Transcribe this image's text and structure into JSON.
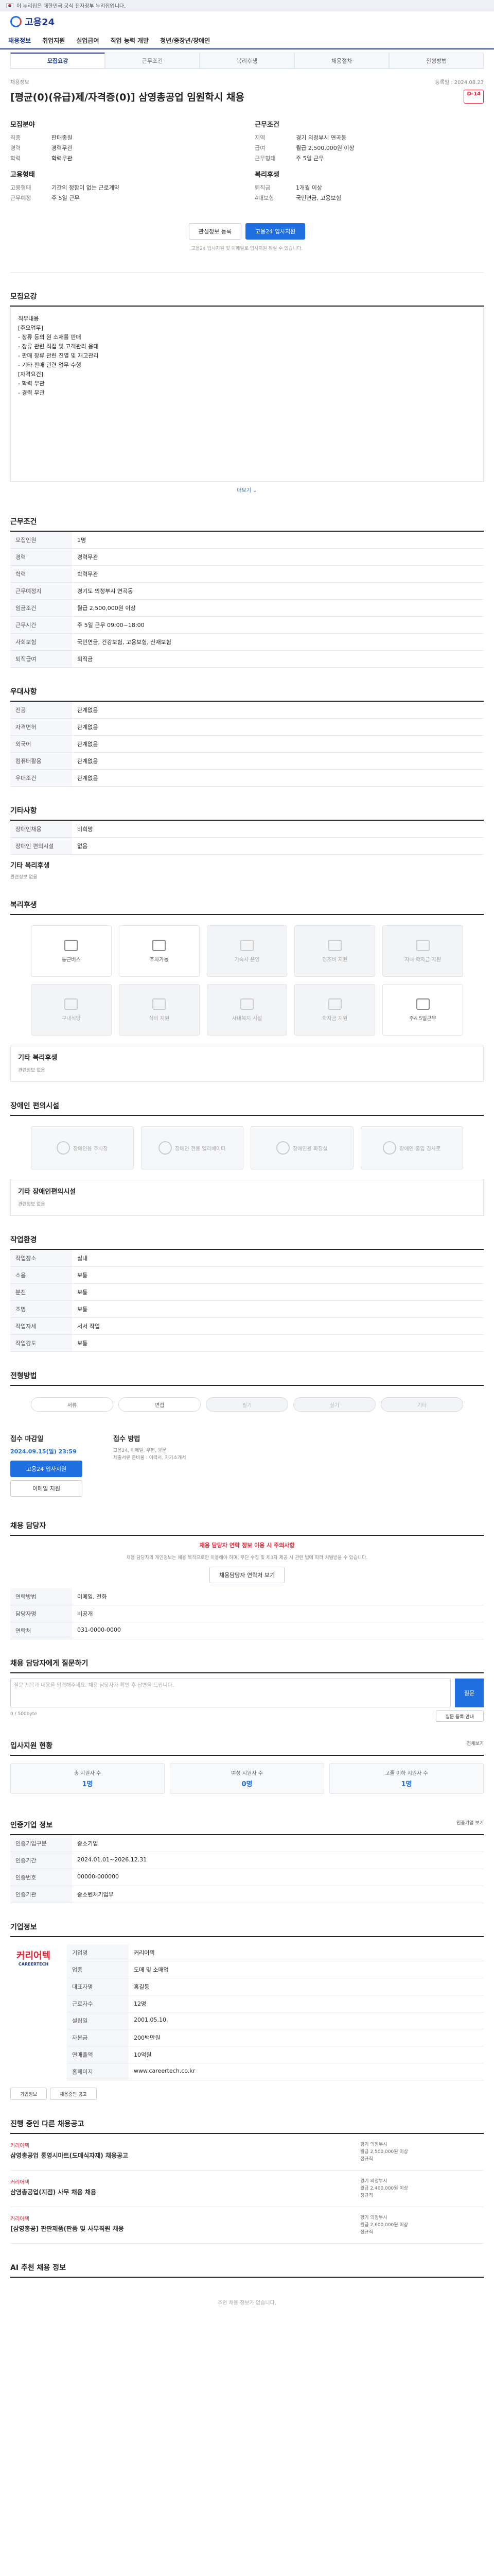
{
  "gov": {
    "text": "이 누리집은 대한민국 공식 전자정부 누리집입니다."
  },
  "site": {
    "name": "고용24",
    "nav": [
      "채용정보",
      "취업지원",
      "실업급여",
      "직업 능력 개발",
      "청년/중장년/장애인"
    ]
  },
  "tabs": [
    "모집요강",
    "근무조건",
    "복리후생",
    "채용절차",
    "전형방법"
  ],
  "job": {
    "meta_left": "채용정보",
    "meta_right": "등록일 : 2024.08.23",
    "title": "[평균(0)(유급)제/자격증(0)] 삼영총공업 임원학시 채용",
    "dday": "D-14",
    "left_label": "모집분야",
    "left_rows": [
      [
        "직종",
        "판매종원"
      ],
      [
        "경력",
        "경력무관"
      ],
      [
        "학력",
        "학력무관"
      ]
    ],
    "right_label": "근무조건",
    "right_rows": [
      [
        "지역",
        "경기 의정부시 연곡동"
      ],
      [
        "급여",
        "월급 2,500,000원 이상"
      ],
      [
        "근무형태",
        "주 5일 근무"
      ]
    ],
    "co_label": "고용형태",
    "co_rows": [
      [
        "고용형태",
        "기간의 정함이 없는 근로계약"
      ],
      [
        "근무예정",
        "주 5일 근무"
      ]
    ],
    "wel_label": "복리후생",
    "wel_rows": [
      [
        "퇴직금",
        "1개월 이상"
      ],
      [
        "4대보험",
        "국민연금, 고용보험"
      ]
    ],
    "btn_scrap": "관심정보 등록",
    "btn_apply": "고용24 입사지원",
    "note": "고용24 입사지원 및 이메일로 입사지원 하실 수 있습니다."
  },
  "sections": {
    "recruit": {
      "title": "모집요강",
      "body": "직무내용\n[주요업무]\n- 장류 등의 원 소재를 판매\n- 장류 관련 직접 및 고객관리 응대\n- 판매 장류 관련 진열 및 재고관리\n- 기타 판매 관련 업무 수행\n[자격요건]\n- 학력 무관\n- 경력 무관",
      "more": "더보기 ⌄"
    },
    "cond": {
      "title": "근무조건",
      "rows": [
        [
          "모집인원",
          "1명"
        ],
        [
          "경력",
          "경력무관"
        ],
        [
          "학력",
          "학력무관"
        ],
        [
          "근무예정지",
          "경기도 의정부시 연곡동"
        ],
        [
          "임금조건",
          "월급 2,500,000원 이상"
        ],
        [
          "근무시간",
          "주 5일 근무 09:00~18:00"
        ],
        [
          "사회보험",
          "국민연금, 건강보험, 고용보험, 산재보험"
        ],
        [
          "퇴직급여",
          "퇴직금"
        ]
      ]
    },
    "pref": {
      "title": "우대사항",
      "rows": [
        [
          "전공",
          "관계없음"
        ],
        [
          "자격면허",
          "관계없음"
        ],
        [
          "외국어",
          "관계없음"
        ],
        [
          "컴퓨터활용",
          "관계없음"
        ],
        [
          "우대조건",
          "관계없음"
        ]
      ]
    },
    "etc": {
      "title": "기타사항",
      "rows": [
        [
          "장애인채용",
          "비희망"
        ],
        [
          "장애인 편의시설",
          "없음"
        ]
      ],
      "sub": "기타 복리후생",
      "note": "관련정보 없음"
    },
    "welfare": {
      "title": "복리후생",
      "items": [
        {
          "l": "통근버스",
          "off": false
        },
        {
          "l": "주차가능",
          "off": false
        },
        {
          "l": "기숙사 운영",
          "off": true
        },
        {
          "l": "경조비 지원",
          "off": true
        },
        {
          "l": "자녀 학자금 지원",
          "off": true
        },
        {
          "l": "구내식당",
          "off": true
        },
        {
          "l": "식비 지원",
          "off": true
        },
        {
          "l": "사내복지 시설",
          "off": true
        },
        {
          "l": "학자금 지원",
          "off": true
        },
        {
          "l": "주4.5일근무",
          "off": false
        }
      ],
      "sub": "기타 복리후생",
      "note": "관련정보 없음"
    },
    "disab": {
      "title": "장애인 편의시설",
      "items": [
        "장애인용 주차장",
        "장애인 전용 엘리베이터",
        "장애인용 화장실",
        "장애인 출입 경사로"
      ],
      "sub": "기타 장애인편의시설",
      "note": "관련정보 없음"
    },
    "workenv": {
      "title": "작업환경",
      "rows": [
        [
          "작업장소",
          "실내"
        ],
        [
          "소음",
          "보통"
        ],
        [
          "분진",
          "보통"
        ],
        [
          "조명",
          "보통"
        ],
        [
          "작업자세",
          "서서 작업"
        ],
        [
          "작업강도",
          "보통"
        ]
      ]
    },
    "steps": {
      "title": "전형방법",
      "items": [
        "서류",
        "면접",
        "필기",
        "실기",
        "기타"
      ],
      "period_label": "접수 마감일",
      "period": "2024.09.15(일) 23:59",
      "method_label": "접수 방법",
      "methods": "고용24, 이메일, 우편, 방문",
      "apply": "고용24 입사지원",
      "email": "이메일 지원",
      "docs": "제출서류 준비물 : 이력서, 자기소개서"
    },
    "manager": {
      "title": "채용 담당자",
      "red": "채용 담당자 연락 정보 이용 시 주의사항",
      "desc": "채용 담당자의 개인정보는 채용 목적으로만 이용해야 하며, 무단 수집 및 제3자 제공 시 관련 법에 따라 처벌받을 수 있습니다.",
      "btn": "채용담당자 연락처 보기",
      "rows": [
        [
          "연락방법",
          "이메일, 전화"
        ],
        [
          "담당자명",
          "비공개"
        ],
        [
          "연락처",
          "031-0000-0000"
        ]
      ]
    },
    "qna": {
      "title": "채용 담당자에게 질문하기",
      "placeholder": "질문 제목과 내용을 입력해주세요. 채용 담당자가 확인 후 답변을 드립니다.",
      "btn": "질문",
      "count": "0 / 500byte",
      "guide": "질문 등록 안내"
    },
    "stat": {
      "title": "입사지원 현황",
      "more": "전체보기",
      "items": [
        {
          "l": "총 지원자 수",
          "v": "1명"
        },
        {
          "l": "여성 지원자 수",
          "v": "0명"
        },
        {
          "l": "고졸 이하 지원자 수",
          "v": "1명"
        }
      ]
    },
    "info": {
      "title": "인증기업 정보",
      "more": "인증기업 보기",
      "rows": [
        [
          "인증기업구분",
          "중소기업"
        ],
        [
          "인증기간",
          "2024.01.01~2026.12.31"
        ],
        [
          "인증번호",
          "00000-000000"
        ],
        [
          "인증기관",
          "중소벤처기업부"
        ]
      ]
    },
    "company": {
      "title": "기업정보",
      "logo": "커리어텍",
      "logo_sub": "CAREERTECH",
      "rows": [
        [
          "기업명",
          "커리어텍"
        ],
        [
          "업종",
          "도매 및 소매업"
        ],
        [
          "대표자명",
          "홍길동"
        ],
        [
          "근로자수",
          "12명"
        ],
        [
          "설립일",
          "2001.05.10."
        ],
        [
          "자본금",
          "200백만원"
        ],
        [
          "연매출액",
          "10억원"
        ],
        [
          "홈페이지",
          "www.careertech.co.kr"
        ]
      ],
      "btns": [
        "기업정보",
        "채용중인 공고"
      ]
    },
    "jobs": {
      "title": "진행 중인 다른 채용공고",
      "items": [
        {
          "comp": "커리어텍",
          "title": "삼영총공업 통영시마트(도매식자재) 채용공고",
          "loc": "경기 의정부시",
          "sal": "월급 2,500,000원 이상",
          "type": "정규직"
        },
        {
          "comp": "커리어텍",
          "title": "삼영총공업(지점) 사무 채용 채용",
          "loc": "경기 의정부시",
          "sal": "월급 2,400,000원 이상",
          "type": "정규직"
        },
        {
          "comp": "커리어텍",
          "title": "[삼영총공] 판판제품(판품 및 사무직원 채용",
          "loc": "경기 의정부시",
          "sal": "월급 2,600,000원 이상",
          "type": "정규직"
        }
      ]
    },
    "rec": {
      "title": "AI 추천 채용 정보",
      "empty": "추천 채용 정보가 없습니다."
    }
  }
}
